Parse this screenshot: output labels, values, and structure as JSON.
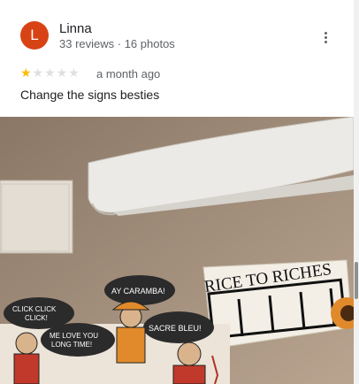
{
  "review": {
    "avatar_letter": "L",
    "author": "Linna",
    "author_meta": "33 reviews · 16 photos",
    "rating": 1,
    "rating_max": 5,
    "time": "a month ago",
    "text": "Change the signs besties"
  },
  "photo": {
    "signs": {
      "brand": "RICE TO RICHES",
      "bubble_1": "AY CARAMBA!",
      "bubble_2a": "CLICK CLICK",
      "bubble_2b": "CLICK!",
      "bubble_3a": "ME LOVE YOU",
      "bubble_3b": "LONG TIME!",
      "bubble_4": "SACRE BLEU!"
    }
  },
  "colors": {
    "avatar": "#d84315",
    "star": "#fbbc04"
  },
  "icons": {
    "more": "more-vert-icon",
    "star": "star-icon"
  }
}
